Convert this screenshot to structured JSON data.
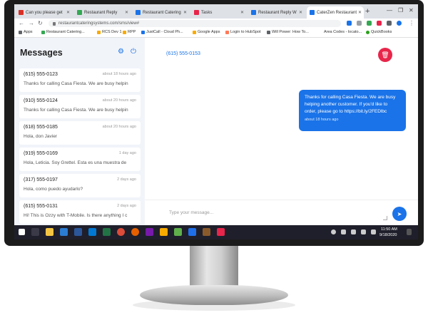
{
  "browser": {
    "tabs": [
      {
        "title": "Can you please get",
        "color": "#d93025",
        "active": false
      },
      {
        "title": "Restaurant Reply",
        "color": "#34a853",
        "active": false
      },
      {
        "title": "Restaurant Catering",
        "color": "#1a73e8",
        "active": false
      },
      {
        "title": "Tasks",
        "color": "#e8254a",
        "active": false
      },
      {
        "title": "Restaurant Reply W",
        "color": "#1a73e8",
        "active": false
      },
      {
        "title": "CaterZen Restaurant",
        "color": "#1a73e8",
        "active": true
      }
    ],
    "new_tab": "+",
    "url": "restaurantcateringsystems.com/sms/view#",
    "bookmarks": [
      "Apps",
      "Restaurant Catering...",
      "RCS Dev 1",
      "RPP",
      "JustCall - Cloud Ph...",
      "Google Apps",
      "Login to HubSpot",
      "Will Power: How To...",
      "Area Codes - locato...",
      "QuickBooks"
    ]
  },
  "sidebar": {
    "title": "Messages",
    "conversations": [
      {
        "phone": "(615) 555-0123",
        "time": "about 18 hours ago",
        "preview": "Thanks for calling Casa Fiesta. We are busy helpin"
      },
      {
        "phone": "(910) 555-0124",
        "time": "about 20 hours ago",
        "preview": "Thanks for calling Casa Fiesta. We are busy helpin"
      },
      {
        "phone": "(618) 555-0185",
        "time": "about 20 hours ago",
        "preview": "Hola, don Javier"
      },
      {
        "phone": "(919) 555-0169",
        "time": "1 day ago",
        "preview": "Hola, Leticia. Soy Grettel. Esta es una muestra de"
      },
      {
        "phone": "(317) 555-0197",
        "time": "2 days ago",
        "preview": "Hola, como puedo ayudarlo?"
      },
      {
        "phone": "(615) 555-0131",
        "time": "2 days ago",
        "preview": "Hi! This is Ozzy with T-Mobile. Is there anything I c"
      }
    ]
  },
  "main": {
    "phone": "(615) 555-0153",
    "message": {
      "text": "Thanks for calling Casa Fiesta. We are busy helping another customer. If you'd like to order, please go to https://bit.ly/2FEDlbc",
      "time": "about 18 hours ago"
    },
    "compose_placeholder": "Type your message..."
  },
  "taskbar": {
    "time": "11:50 AM",
    "date": "9/18/2020"
  }
}
